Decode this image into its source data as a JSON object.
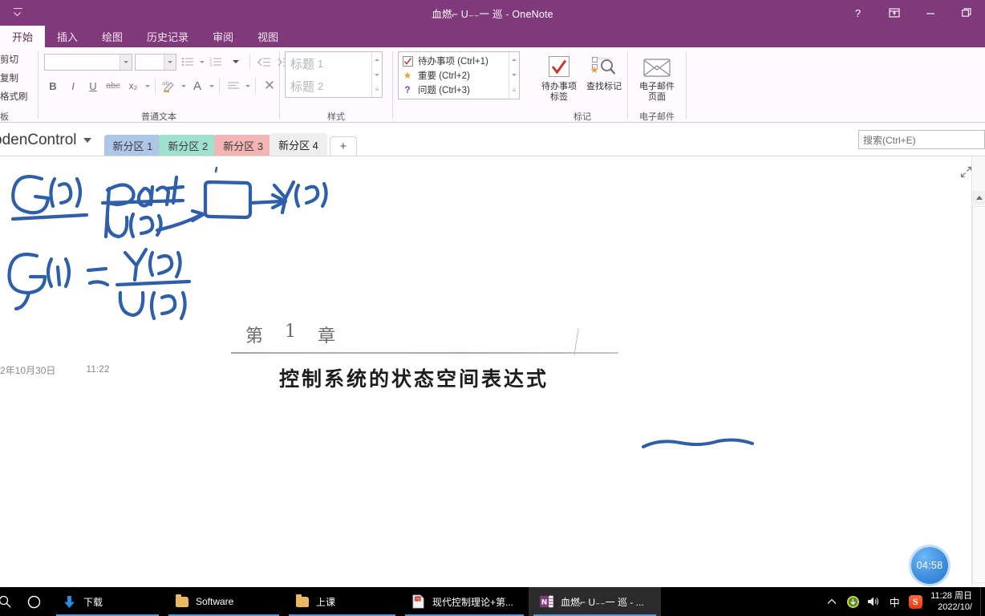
{
  "window": {
    "title": "血燃⌐ U₋₋一 巡 - OneNote",
    "qat_name": "quick-access-toolbar",
    "controls": {
      "help": "?",
      "ribbon_display": "▣",
      "minimize": "—",
      "restore": "❐"
    }
  },
  "ribbon": {
    "tabs": [
      {
        "label": "开始",
        "active": true
      },
      {
        "label": "插入",
        "active": false
      },
      {
        "label": "绘图",
        "active": false
      },
      {
        "label": "历史记录",
        "active": false
      },
      {
        "label": "审阅",
        "active": false
      },
      {
        "label": "视图",
        "active": false
      }
    ],
    "clipboard": {
      "group_label": "板",
      "items": [
        "剪切",
        "复制",
        "格式刷"
      ]
    },
    "text": {
      "group_label": "普通文本",
      "font_value": "",
      "font_size_value": "",
      "bold": "B",
      "italic": "I",
      "underline": "U",
      "strike": "abc",
      "subscript": "x₂",
      "highlight": "ab",
      "font_color": "A",
      "align": "≡",
      "clear_formatting": "✕"
    },
    "styles": {
      "group_label": "样式",
      "items": [
        {
          "text": "标题",
          "num": "1"
        },
        {
          "text": "标题",
          "num": "2"
        }
      ]
    },
    "tags": {
      "group_label": "标记",
      "items": [
        {
          "icon": "checkbox-icon",
          "glyph": "✓",
          "label": "待办事项 (Ctrl+1)"
        },
        {
          "icon": "star-icon",
          "glyph": "★",
          "label": "重要 (Ctrl+2)"
        },
        {
          "icon": "question-icon",
          "glyph": "?",
          "label": "问题 (Ctrl+3)"
        }
      ],
      "todo_tag_button": "待办事项\n标签",
      "todo_tag_line1": "待办事项",
      "todo_tag_line2": "标签",
      "find_tags_button": "查找标记"
    },
    "email": {
      "group_label": "电子邮件",
      "button_line1": "电子邮件",
      "button_line2": "页面"
    }
  },
  "sections": {
    "notebook_name": "odenControl",
    "tabs": [
      {
        "label": "新分区 1",
        "color": "#aec7e8",
        "active": false
      },
      {
        "label": "新分区 2",
        "color": "#9fe0cf",
        "active": false
      },
      {
        "label": "新分区 3",
        "color": "#f3b4b4",
        "active": false
      },
      {
        "label": "新分区 4",
        "color": "#eeeeee",
        "active": true
      }
    ],
    "add_section": "+",
    "search_placeholder": "搜索(Ctrl+E)"
  },
  "page": {
    "date": "2年10月30日",
    "time": "11:22",
    "scan": {
      "chapter_prefix": "第",
      "chapter_number": "1",
      "chapter_suffix": "章",
      "heading": "控制系统的状态空间表达式"
    },
    "ink": {
      "line1_left": "G(S)",
      "line1_mid_top": "plant",
      "line1_mid_bottom": "U(S)",
      "line1_right": "Y(S)",
      "line2_left": "G(S)",
      "line2_eq": "=",
      "line2_num": "Y(S)",
      "line2_den": "U (S)"
    },
    "ink_color": "#2f5fa8",
    "expand_icon": "expand-icon"
  },
  "timer": {
    "value": "04:58"
  },
  "taskbar": {
    "search_icon": "search-icon",
    "cortana_icon": "cortana-icon",
    "items": [
      {
        "label": "下载",
        "icon": "download-arrow-icon",
        "active": false
      },
      {
        "label": "Software",
        "icon": "folder-icon",
        "active": false
      },
      {
        "label": "上课",
        "icon": "folder-icon",
        "active": false
      },
      {
        "label": "现代控制理论+第...",
        "icon": "pdf-icon",
        "active": false
      },
      {
        "label": "血燃⌐ U₋₋一 巡 - ...",
        "icon": "onenote-icon",
        "active": true
      }
    ],
    "tray": {
      "chevron": "⌃",
      "update_icon": "update-icon",
      "volume_icon": "volume-icon",
      "ime": "中",
      "sogou": "S",
      "time": "11:28 周日",
      "date": "2022/10/"
    }
  }
}
